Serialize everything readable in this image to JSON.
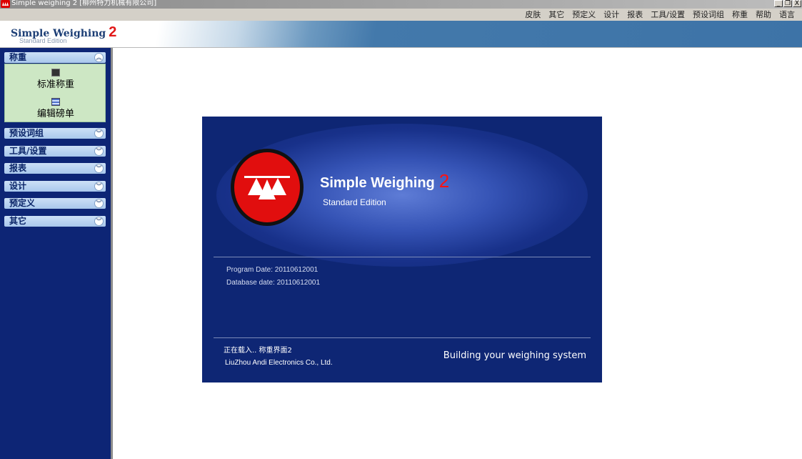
{
  "window": {
    "title": "Simple weighing 2 [柳州特力机械有限公司]",
    "buttons": [
      "_",
      "❐",
      "X"
    ]
  },
  "menu": {
    "items": [
      "皮肤",
      "其它",
      "预定义",
      "设计",
      "报表",
      "工具/设置",
      "预设词组",
      "称重",
      "帮助",
      "语言"
    ]
  },
  "banner": {
    "brand": "Simple Weighing",
    "brand_num": "2",
    "edition": "Standard Edition"
  },
  "sidebar": {
    "panels": [
      {
        "label": "称重",
        "expanded": true,
        "tools": [
          "标准称重",
          "编辑磅单"
        ]
      },
      {
        "label": "预设词组",
        "expanded": false
      },
      {
        "label": "工具/设置",
        "expanded": false
      },
      {
        "label": "报表",
        "expanded": false
      },
      {
        "label": "设计",
        "expanded": false
      },
      {
        "label": "预定义",
        "expanded": false
      },
      {
        "label": "其它",
        "expanded": false
      }
    ],
    "collapse_glyph": "︽",
    "expand_glyph": "︾"
  },
  "splash": {
    "title": "Simple Weighing",
    "title_num": "2",
    "edition": "Standard Edition",
    "program_date": "Program Date: 20110612001",
    "database_date": "Database date: 20110612001",
    "status": "正在载入.. 称重界面2",
    "company": "LiuZhou Andi Electronics Co., Ltd.",
    "slogan": "Building your weighing system"
  },
  "colors": {
    "sidebar_bg": "#0d2575",
    "splash_bg": "#0e2674",
    "accent_red": "#e10e0e"
  },
  "icons": {
    "app": "scale-logo-icon",
    "tool_1": "monitor-icon",
    "tool_2": "list-icon"
  }
}
